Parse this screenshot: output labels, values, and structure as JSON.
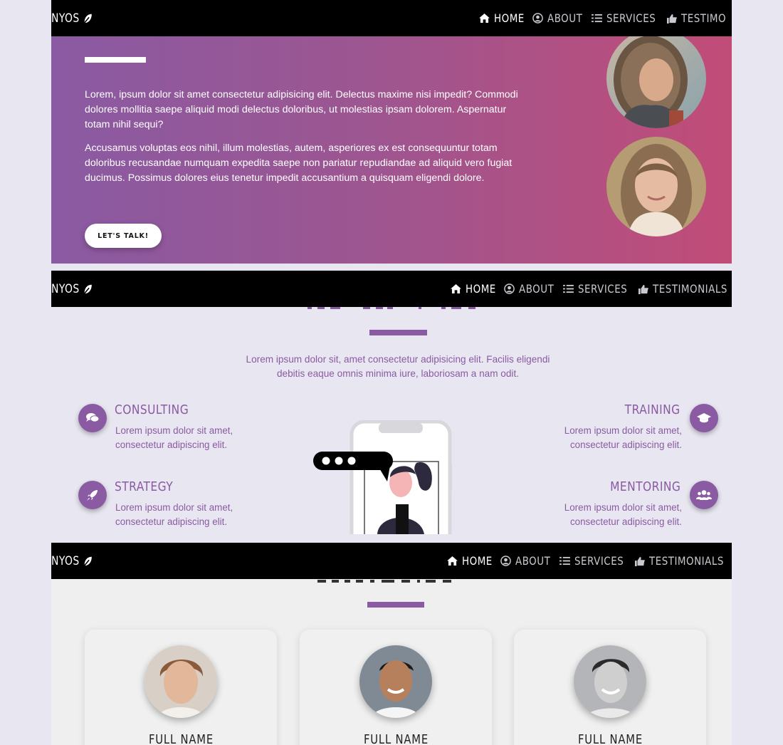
{
  "nav": {
    "brand_label": "NYOS",
    "items": [
      {
        "label": "HOME"
      },
      {
        "label": "ABOUT"
      },
      {
        "label": "SERVICES"
      },
      {
        "label": "TESTIMONIALS"
      }
    ],
    "clipped_label": "TESTIMO"
  },
  "hero": {
    "paragraph_1": "Lorem, ipsum dolor sit amet consectetur adipisicing elit. Delectus maxime nisi impedit? Commodi dolores mollitia saepe aliquid modi delectus doloribus, ut molestias ipsam dolorem. Aspernatur totam nihil sequi?",
    "paragraph_2": "Accusamus voluptas eos nihil, illum molestias, autem, asperiores ex est consequuntur totam doloribus recusandae numquam expedita saepe non pariatur repudiandae ad aliquid vero fugiat ducimus. Possimus dolores eius tenetur impedit accusantium a quisquam eligendi dolore.",
    "cta_label": "LET'S TALK!"
  },
  "services": {
    "lead": "Lorem ipsum dolor sit, amet consectetur adipisicing elit. Facilis eligendi debitis eaque omnis minima iure, laboriosam a nam odit.",
    "items": [
      {
        "title": "CONSULTING",
        "desc": "Lorem ipsum dolor sit amet, consectetur adipiscing elit.",
        "icon": "comments-icon"
      },
      {
        "title": "TRAINING",
        "desc": "Lorem ipsum dolor sit amet, consectetur adipiscing elit.",
        "icon": "graduation-cap-icon"
      },
      {
        "title": "STRATEGY",
        "desc": "Lorem ipsum dolor sit amet, consectetur adipiscing elit.",
        "icon": "rocket-icon"
      },
      {
        "title": "MENTORING",
        "desc": "Lorem ipsum dolor sit amet, consectetur adipiscing elit.",
        "icon": "users-icon"
      }
    ]
  },
  "testimonials": {
    "cards": [
      {
        "name": "FULL NAME"
      },
      {
        "name": "FULL NAME"
      },
      {
        "name": "FULL NAME"
      }
    ]
  },
  "colors": {
    "accent": "#8a5aa2",
    "gradient_start": "#8a5aa2",
    "gradient_end": "#c14c78",
    "navbar": "#000000"
  }
}
